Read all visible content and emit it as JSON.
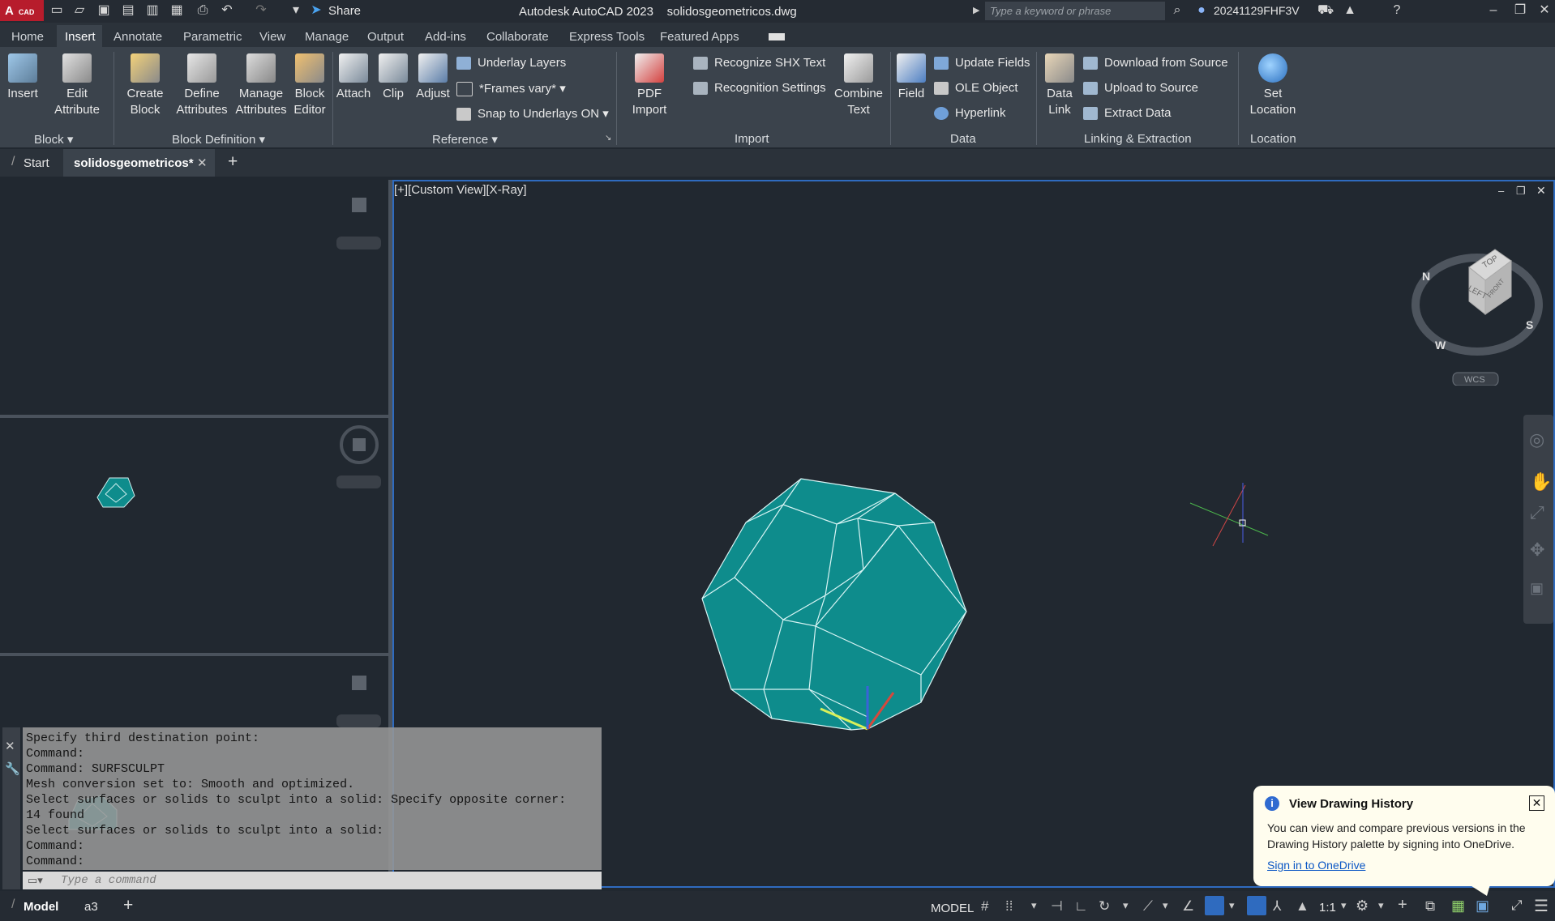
{
  "app": {
    "logo_text": "A",
    "logo_sub": "CAD",
    "title": "Autodesk AutoCAD 2023    solidosgeometricos.dwg",
    "share_label": "Share",
    "search_placeholder": "Type a keyword or phrase",
    "user": "20241129FHF3V"
  },
  "menu": {
    "tabs": [
      "Home",
      "Insert",
      "Annotate",
      "Parametric",
      "View",
      "Manage",
      "Output",
      "Add-ins",
      "Collaborate",
      "Express Tools",
      "Featured Apps"
    ],
    "active": "Insert"
  },
  "ribbon": {
    "block": {
      "insert": "Insert",
      "edit_attribute_1": "Edit",
      "edit_attribute_2": "Attribute",
      "title": "Block"
    },
    "block_def": {
      "create_1": "Create",
      "create_2": "Block",
      "define_1": "Define",
      "define_2": "Attributes",
      "manage_1": "Manage",
      "manage_2": "Attributes",
      "editor_1": "Block",
      "editor_2": "Editor",
      "title": "Block Definition"
    },
    "reference": {
      "attach": "Attach",
      "clip": "Clip",
      "adjust": "Adjust",
      "underlay_layers": "Underlay Layers",
      "frames_vary": "*Frames vary*",
      "snap_underlays": "Snap to Underlays ON",
      "title": "Reference"
    },
    "import": {
      "pdf_1": "PDF",
      "pdf_2": "Import",
      "recognize_shx": "Recognize SHX Text",
      "recognition_settings": "Recognition Settings",
      "combine_1": "Combine",
      "combine_2": "Text",
      "title": "Import"
    },
    "data": {
      "field": "Field",
      "update_fields": "Update Fields",
      "ole_object": "OLE Object",
      "hyperlink": "Hyperlink",
      "title": "Data"
    },
    "linking": {
      "data_link_1": "Data",
      "data_link_2": "Link",
      "download": "Download from Source",
      "upload": "Upload to Source",
      "extract": "Extract  Data",
      "title": "Linking & Extraction"
    },
    "location": {
      "set_1": "Set",
      "set_2": "Location",
      "title": "Location"
    }
  },
  "file_tabs": {
    "start": "Start",
    "active": "solidosgeometricos*"
  },
  "viewport": {
    "label": "[+][Custom View][X-Ray]",
    "viewcube_top": "TOP",
    "viewcube_left": "LEFT",
    "viewcube_front": "FRONT",
    "compass_n": "N",
    "compass_s": "S",
    "compass_w": "W",
    "wcs": "WCS"
  },
  "command": {
    "lines": "Specify third destination point:\nCommand:\nCommand: SURFSCULPT\nMesh conversion set to: Smooth and optimized.\nSelect surfaces or solids to sculpt into a solid: Specify opposite corner:\n14 found\nSelect surfaces or solids to sculpt into a solid:\nCommand:\nCommand:",
    "placeholder": "Type a command"
  },
  "status": {
    "model_tab": "Model",
    "layout_tab": "a3",
    "model_label": "MODEL",
    "scale": "1:1"
  },
  "notification": {
    "title": "View Drawing History",
    "body": "You can view and compare previous versions in the Drawing History palette by signing into OneDrive.",
    "link": "Sign in to OneDrive"
  },
  "colors": {
    "solid_fill": "#0e8c8c",
    "solid_edge": "#cfeeee",
    "accent": "#2f6bbf",
    "background": "#212830"
  }
}
